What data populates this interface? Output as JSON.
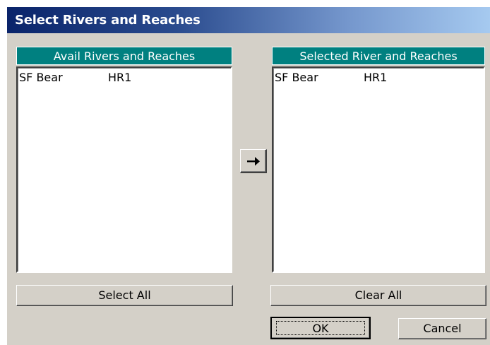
{
  "dialog": {
    "title": "Select Rivers and Reaches"
  },
  "available_list": {
    "header": "Avail Rivers and Reaches",
    "items": [
      {
        "river": "SF Bear",
        "reach": "HR1"
      }
    ]
  },
  "selected_list": {
    "header": "Selected River and Reaches",
    "items": [
      {
        "river": "SF Bear",
        "reach": "HR1"
      }
    ]
  },
  "buttons": {
    "select_all": "Select All",
    "clear_all": "Clear All",
    "ok": "OK",
    "cancel": "Cancel",
    "move_right_icon": "arrow-right-icon"
  }
}
